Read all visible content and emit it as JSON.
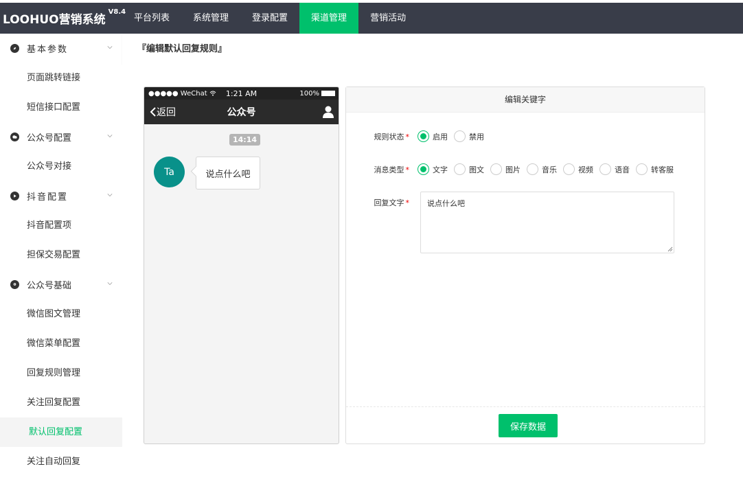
{
  "app": {
    "logo": "LOOHUO营销系统",
    "version": "V8.4"
  },
  "topnav": {
    "items": [
      "平台列表",
      "系统管理",
      "登录配置",
      "渠道管理",
      "营销活动"
    ],
    "active_index": 3
  },
  "sidebar": {
    "groups": [
      {
        "label": "基本参数",
        "icon": "compass-icon",
        "items": [
          "页面跳转链接",
          "短信接口配置"
        ]
      },
      {
        "label": "公众号配置",
        "icon": "wechat-icon",
        "items": [
          "公众号对接"
        ]
      },
      {
        "label": "抖音配置",
        "icon": "play-icon",
        "items": [
          "抖音配置项",
          "担保交易配置"
        ]
      },
      {
        "label": "公众号基础",
        "icon": "location-icon",
        "items": [
          "微信图文管理",
          "微信菜单配置",
          "回复规则管理",
          "关注回复配置",
          "默认回复配置",
          "关注自动回复"
        ]
      }
    ],
    "active_item": "默认回复配置"
  },
  "breadcrumb": "『编辑默认回复规则』",
  "phone": {
    "carrier": "●●●●● WeChat",
    "time": "1:21 AM",
    "battery": "100%",
    "back": "返回",
    "title": "公众号",
    "msg_time": "14:14",
    "avatar_text": "Ta",
    "message": "说点什么吧"
  },
  "panel": {
    "title": "编辑关键字",
    "status": {
      "label": "规则状态",
      "options": [
        "启用",
        "禁用"
      ],
      "selected": "启用"
    },
    "msgtype": {
      "label": "消息类型",
      "options": [
        "文字",
        "图文",
        "图片",
        "音乐",
        "视频",
        "语音",
        "转客服"
      ],
      "selected": "文字"
    },
    "reply": {
      "label": "回复文字",
      "value": "说点什么吧"
    },
    "save": "保存数据"
  },
  "colors": {
    "accent": "#00c06c",
    "topbar": "#393d49",
    "avatar": "#09918a"
  }
}
